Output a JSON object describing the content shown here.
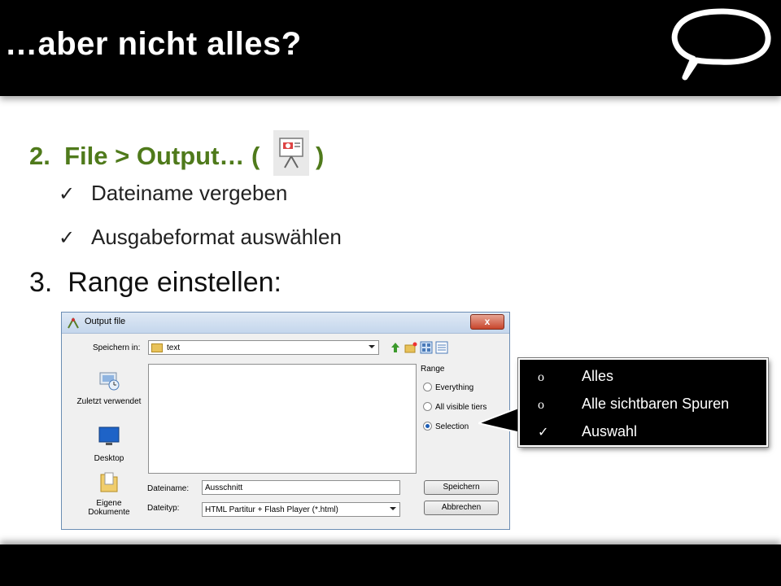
{
  "slide": {
    "title": "…aber nicht alles?",
    "item2": {
      "number": "2.",
      "text": "File > Output… (",
      "close": ")"
    },
    "checks": [
      {
        "mark": "✓",
        "text": "Dateiname vergeben"
      },
      {
        "mark": "✓",
        "text": "Ausgabeformat auswählen"
      }
    ],
    "item3": {
      "number": "3.",
      "text": "Range einstellen:"
    }
  },
  "dialog": {
    "title": "Output file",
    "close": "x",
    "save_in_label": "Speichern in:",
    "save_in_value": "text",
    "places": [
      {
        "label": "Zuletzt verwendet",
        "icon": "recent-icon"
      },
      {
        "label": "Desktop",
        "icon": "desktop-icon"
      },
      {
        "label": "Eigene Dokumente",
        "icon": "documents-folder-icon"
      }
    ],
    "range": {
      "title": "Range",
      "options": [
        "Everything",
        "All visible tiers",
        "Selection"
      ],
      "selected": "Selection"
    },
    "filename_label": "Dateiname:",
    "filename_value": "Ausschnitt",
    "filetype_label": "Dateityp:",
    "filetype_value": "HTML Partitur + Flash Player (*.html)",
    "save_button": "Speichern",
    "cancel_button": "Abbrechen"
  },
  "callout": {
    "items": [
      {
        "bullet": "o",
        "text": "Alles"
      },
      {
        "bullet": "o",
        "text": "Alle sichtbaren Spuren"
      },
      {
        "bullet": "✓",
        "text": "Auswahl"
      }
    ]
  },
  "colors": {
    "accent_green": "#4f7a1b",
    "bar": "#000000"
  }
}
